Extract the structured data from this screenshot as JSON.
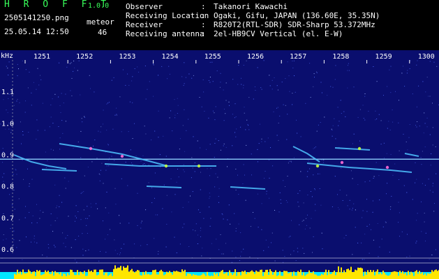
{
  "header": {
    "app_title": "H R O F F T",
    "app_version": "1.0.0",
    "file_name": "2505141250.png",
    "date_time": "25.05.14 12:50",
    "meteor_label": "meteor",
    "meteor_count": "46",
    "info": [
      {
        "label": "Observer",
        "value": "Takanori Kawachi"
      },
      {
        "label": "Receiving Location",
        "value": "Ogaki, Gifu, JAPAN (136.60E, 35.35N)"
      },
      {
        "label": "Receiver",
        "value": "R820T2(RTL-SDR) SDR-Sharp 53.372MHz"
      },
      {
        "label": "Receiving antenna",
        "value": "2el-HB9CV Vertical (el. E-W)"
      }
    ],
    "separator": ":"
  },
  "chart_data": {
    "type": "heatmap",
    "y_unit": "kHz",
    "x_ticks": [
      "1251",
      "1252",
      "1253",
      "1254",
      "1255",
      "1256",
      "1257",
      "1258",
      "1259",
      "1300"
    ],
    "y_ticks": [
      "1.1",
      "1.0",
      "0.9",
      "0.8",
      "0.7",
      "0.6"
    ],
    "ylim": [
      0.58,
      1.2
    ],
    "carrier_khz": 0.885,
    "colors": {
      "background": "#0a0e6e",
      "noise": "#4f6dff",
      "carrier": "#8fd0ff",
      "echo": "#4fc3ff",
      "echo_hot": "#c8ff3c",
      "echo_peak": "#ff6ad5",
      "level": "#ffe600",
      "level_base": "#00e6ff",
      "grid": "#ffffff"
    }
  }
}
